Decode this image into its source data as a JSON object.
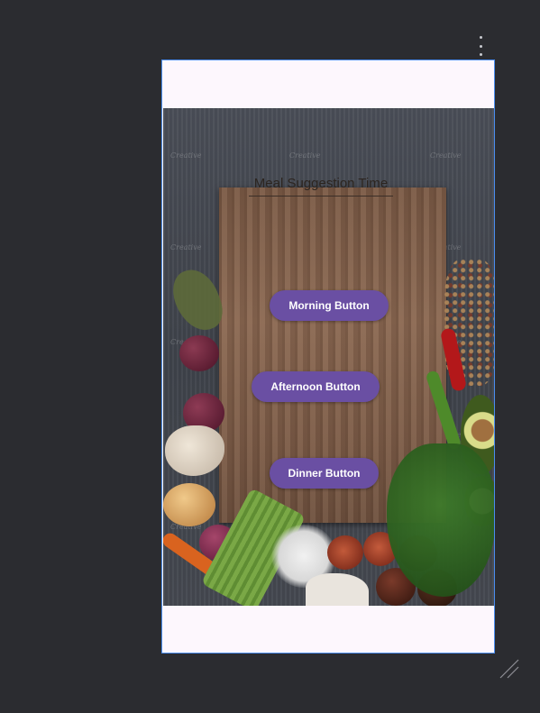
{
  "toolbar": {
    "menu_icon": "more-vert-icon"
  },
  "screen": {
    "title": "Meal Suggestion Time",
    "buttons": {
      "morning": "Morning Button",
      "afternoon": "Afternoon Button",
      "dinner": "Dinner Button"
    },
    "background_image": {
      "watermark": "Creative"
    }
  },
  "colors": {
    "button": "#6a4fa3",
    "button_text": "#ffffff",
    "device_border": "#4a8df0",
    "workspace": "#2b2c30",
    "device_background": "#fdf7fd"
  }
}
